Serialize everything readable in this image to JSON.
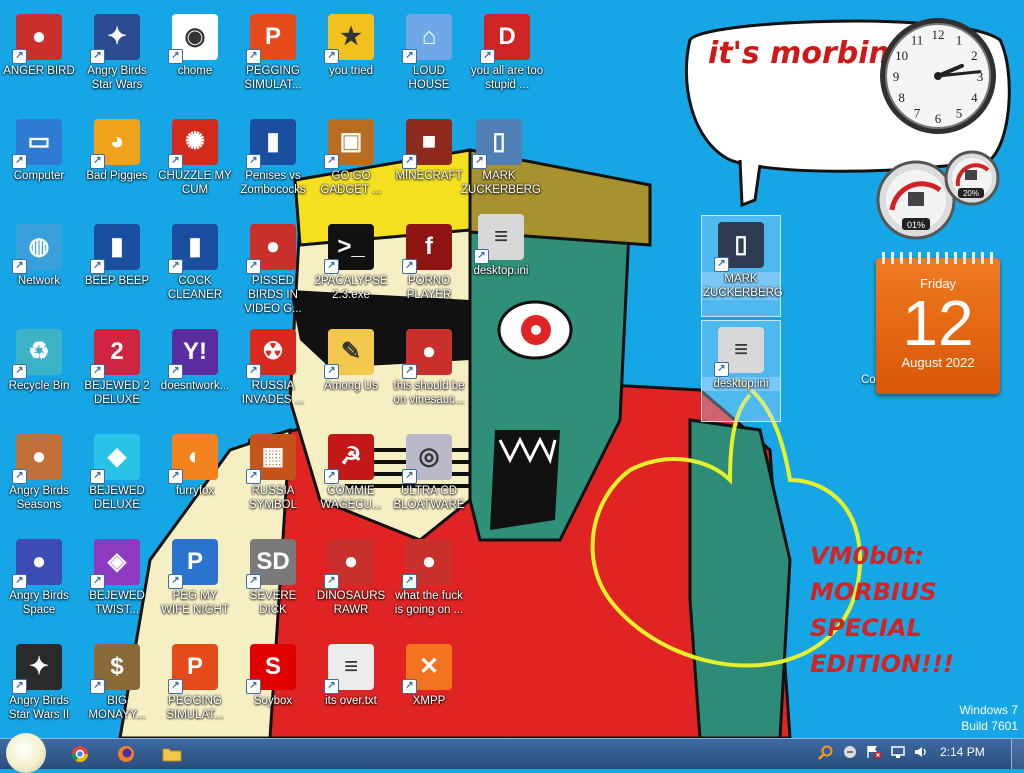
{
  "desktop_icons": [
    {
      "label": "ANGER BIRD",
      "icon": "angry-bird-icon",
      "color": "#c9302c",
      "glyph": "●"
    },
    {
      "label": "Angry Birds Star Wars",
      "icon": "angry-birds-star-wars-icon",
      "color": "#2a4b8f",
      "glyph": "✦"
    },
    {
      "label": "chome",
      "icon": "chrome-icon",
      "color": "#ffffff",
      "glyph": "◉"
    },
    {
      "label": "PEGGING SIMULAT...",
      "icon": "pegging-icon",
      "color": "#e44a1a",
      "glyph": "P"
    },
    {
      "label": "you tried",
      "icon": "gold-star-icon",
      "color": "#f3c11b",
      "glyph": "★"
    },
    {
      "label": "LOUD HOUSE",
      "icon": "loud-house-icon",
      "color": "#6fa8e8",
      "glyph": "⌂"
    },
    {
      "label": "you all are too stupid ...",
      "icon": "dev-cpp-icon",
      "color": "#d02525",
      "glyph": "D"
    },
    {
      "label": "Computer",
      "icon": "computer-icon",
      "color": "#2e7bd1",
      "glyph": "▭"
    },
    {
      "label": "Bad Piggies",
      "icon": "bad-piggies-icon",
      "color": "#f0a31a",
      "glyph": "◕"
    },
    {
      "label": "CHUZZLE MY CUM",
      "icon": "chuzzle-icon",
      "color": "#d22b1c",
      "glyph": "✺"
    },
    {
      "label": "Penises vs Zombococks",
      "icon": "blue-book-icon",
      "color": "#1a4fa0",
      "glyph": "▮"
    },
    {
      "label": "GO GO GADGET ...",
      "icon": "briefcase-icon",
      "color": "#b96d22",
      "glyph": "▣"
    },
    {
      "label": "MINECRAFT",
      "icon": "minecraft-icon",
      "color": "#8d2a1d",
      "glyph": "■"
    },
    {
      "label": "MARK ZUCKERBERG",
      "icon": "video-file-icon",
      "color": "#4f7fb5",
      "glyph": "▯"
    },
    {
      "label": "Network",
      "icon": "network-icon",
      "color": "#3aa0dc",
      "glyph": "◍"
    },
    {
      "label": "BEEP BEEP",
      "icon": "blue-book-icon",
      "color": "#1a4fa0",
      "glyph": "▮"
    },
    {
      "label": "COCK CLEANER",
      "icon": "blue-book-icon",
      "color": "#1a4fa0",
      "glyph": "▮"
    },
    {
      "label": "PISSED BIRDS IN VIDEO G...",
      "icon": "angry-bird-icon",
      "color": "#c9302c",
      "glyph": "●"
    },
    {
      "label": "2PACALYPSE 2.3.exe",
      "icon": "console-icon",
      "color": "#111111",
      "glyph": ">_"
    },
    {
      "label": "PORNO PLAYER",
      "icon": "flash-player-icon",
      "color": "#8e1511",
      "glyph": "f"
    },
    {
      "label": "desktop.ini",
      "icon": "config-file-icon",
      "color": "#d8d8d8",
      "glyph": "≡"
    },
    {
      "label": "Recycle Bin",
      "icon": "recycle-bin-icon",
      "color": "#3db3c7",
      "glyph": "♻"
    },
    {
      "label": "BEJEWED 2 DELUXE",
      "icon": "bejeweled-2-icon",
      "color": "#d02540",
      "glyph": "2"
    },
    {
      "label": "doesntwork...",
      "icon": "yahoo-messenger-icon",
      "color": "#5a2ca0",
      "glyph": "Y!"
    },
    {
      "label": "RUSSIA INVADES ...",
      "icon": "radiation-icon",
      "color": "#d92a1f",
      "glyph": "☢"
    },
    {
      "label": "Among Us",
      "icon": "folder-doc-icon",
      "color": "#f2c94c",
      "glyph": "✎"
    },
    {
      "label": "this should be on vinesauc...",
      "icon": "angry-bird-icon",
      "color": "#c9302c",
      "glyph": "●"
    },
    {
      "label": "Angry Birds Seasons",
      "icon": "angry-birds-seasons-icon",
      "color": "#c2703a",
      "glyph": "●"
    },
    {
      "label": "BEJEWED DELUXE",
      "icon": "gem-icon",
      "color": "#2ac3e8",
      "glyph": "◆"
    },
    {
      "label": "furryfox",
      "icon": "firefox-icon",
      "color": "#f3821e",
      "glyph": "◐"
    },
    {
      "label": "RUSSIA SYMBOL",
      "icon": "russia-symbol-icon",
      "color": "#c5541c",
      "glyph": "▦"
    },
    {
      "label": "COMMIE WAGECU...",
      "icon": "commie-icon",
      "color": "#c21818",
      "glyph": "☭"
    },
    {
      "label": "ULTRA CD BLOATWARE",
      "icon": "cd-icon",
      "color": "#b9b9c9",
      "glyph": "◎"
    },
    {
      "label": "Angry Birds Space",
      "icon": "angry-birds-space-icon",
      "color": "#3c4cb4",
      "glyph": "●"
    },
    {
      "label": "BEJEWED TWIST...",
      "icon": "bejeweled-twist-icon",
      "color": "#8d3ac1",
      "glyph": "◈"
    },
    {
      "label": "PEG MY WIFE NIGHT",
      "icon": "pegging-icon",
      "color": "#2a73cf",
      "glyph": "P"
    },
    {
      "label": "SEVERE DICK",
      "icon": "gear-sd-icon",
      "color": "#7a7a7a",
      "glyph": "SD"
    },
    {
      "label": "DINOSAURS RAWR",
      "icon": "angry-bird-icon",
      "color": "#c9302c",
      "glyph": "●"
    },
    {
      "label": "what the fuck is going on ...",
      "icon": "angry-bird-icon",
      "color": "#c9302c",
      "glyph": "●"
    },
    {
      "label": "Angry Birds Star Wars II",
      "icon": "angry-birds-star-wars-icon",
      "color": "#2a2a2a",
      "glyph": "✦"
    },
    {
      "label": "BIG MONAYY...",
      "icon": "money-bag-icon",
      "color": "#8b6a3a",
      "glyph": "$"
    },
    {
      "label": "PEGGING SIMULAT...",
      "icon": "pegging-icon",
      "color": "#e44a1a",
      "glyph": "P"
    },
    {
      "label": "Soybox",
      "icon": "soybox-icon",
      "color": "#e00000",
      "glyph": "S"
    },
    {
      "label": "its over.txt",
      "icon": "text-file-icon",
      "color": "#ececec",
      "glyph": "≡"
    },
    {
      "label": "XMPP",
      "icon": "xampp-icon",
      "color": "#f37320",
      "glyph": "✕"
    },
    {
      "label": "MARK ZUCKERBERG",
      "icon": "video-file-icon",
      "color": "#2f3b52",
      "glyph": "▯",
      "selected": true
    },
    {
      "label": "desktop.ini",
      "icon": "config-file-icon",
      "color": "#d8d8d8",
      "glyph": "≡",
      "selected": true
    }
  ],
  "speech_bubble": {
    "text": "it's morbin"
  },
  "clock_gadget": {
    "hour": 2,
    "minute": 14
  },
  "cpu_meter": {
    "cpu": "01%",
    "memory": "20%"
  },
  "calendar": {
    "day": "Friday",
    "date": "12",
    "month": "August 2022"
  },
  "partial_label": "Co",
  "wallpaper_text": "VM0b0t:\nMORBIUS\nSPECIAL\nEDITION!!!",
  "watermark": {
    "line1": "Windows 7",
    "line2": "Build 7601"
  },
  "taskbar": {
    "pinned": [
      {
        "name": "chrome-taskbar-button",
        "icon": "chrome-icon"
      },
      {
        "name": "firefox-taskbar-button",
        "icon": "firefox-icon"
      },
      {
        "name": "explorer-taskbar-button",
        "icon": "folder-icon"
      }
    ],
    "time": "2:14 PM"
  }
}
